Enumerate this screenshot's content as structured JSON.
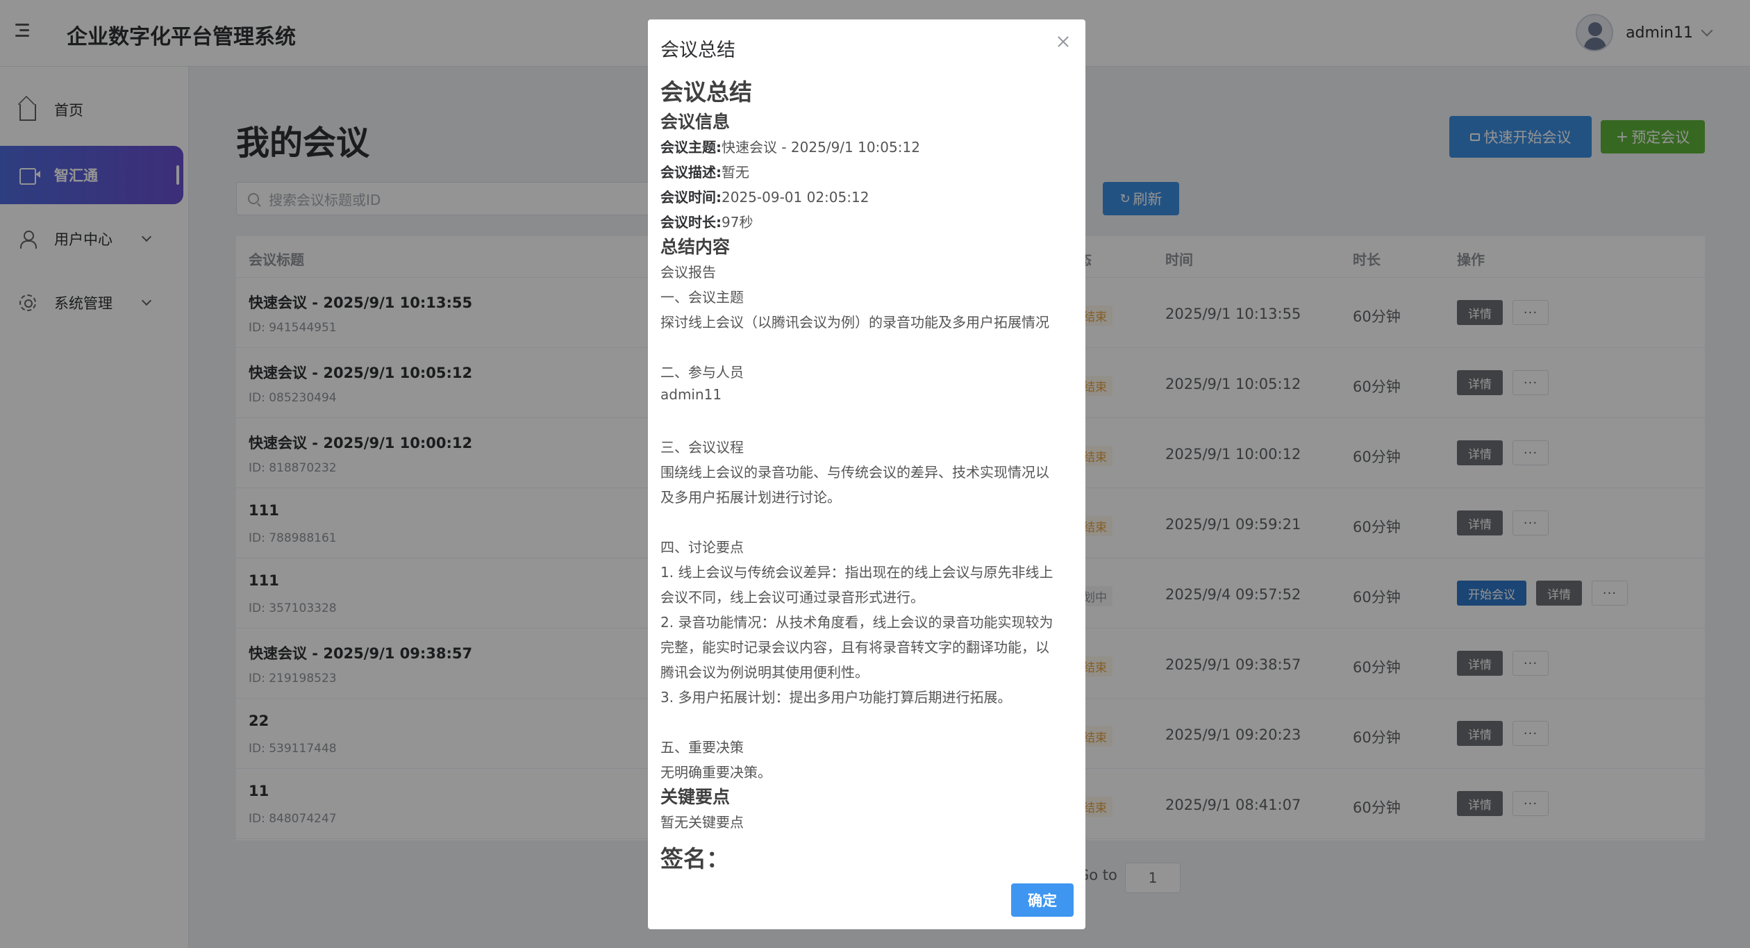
{
  "header": {
    "app_title": "企业数字化平台管理系统",
    "username": "admin11"
  },
  "sidebar": {
    "items": [
      {
        "label": "首页",
        "icon": "home-icon"
      },
      {
        "label": "智汇通",
        "icon": "video-icon"
      },
      {
        "label": "用户中心",
        "icon": "user-icon"
      },
      {
        "label": "系统管理",
        "icon": "gear-icon"
      }
    ]
  },
  "main": {
    "page_title": "我的会议",
    "quick_start_label": "快速开始会议",
    "book_label": "预定会议",
    "refresh_label": "刷新",
    "search_placeholder": "搜索会议标题或ID",
    "columns": {
      "title": "会议标题",
      "status": "态",
      "time": "时间",
      "duration": "时长",
      "ops": "操作"
    },
    "rows": [
      {
        "title": "快速会议 - 2025/9/1 10:13:55",
        "id": "ID: 941544951",
        "status": "结束",
        "time": "2025/9/1 10:13:55",
        "duration": "60分钟",
        "start": "",
        "detail": "详情",
        "more": "···"
      },
      {
        "title": "快速会议 - 2025/9/1 10:05:12",
        "id": "ID: 085230494",
        "status": "结束",
        "time": "2025/9/1 10:05:12",
        "duration": "60分钟",
        "start": "",
        "detail": "详情",
        "more": "···"
      },
      {
        "title": "快速会议 - 2025/9/1 10:00:12",
        "id": "ID: 818870232",
        "status": "结束",
        "time": "2025/9/1 10:00:12",
        "duration": "60分钟",
        "start": "",
        "detail": "详情",
        "more": "···"
      },
      {
        "title": "111",
        "id": "ID: 788988161",
        "status": "结束",
        "time": "2025/9/1 09:59:21",
        "duration": "60分钟",
        "start": "",
        "detail": "详情",
        "more": "···"
      },
      {
        "title": "111",
        "id": "ID: 357103328",
        "status": "划中",
        "time": "2025/9/4 09:57:52",
        "duration": "60分钟",
        "start": "开始会议",
        "detail": "详情",
        "more": "···"
      },
      {
        "title": "快速会议 - 2025/9/1 09:38:57",
        "id": "ID: 219198523",
        "status": "结束",
        "time": "2025/9/1 09:38:57",
        "duration": "60分钟",
        "start": "",
        "detail": "详情",
        "more": "···"
      },
      {
        "title": "22",
        "id": "ID: 539117448",
        "status": "结束",
        "time": "2025/9/1 09:20:23",
        "duration": "60分钟",
        "start": "",
        "detail": "详情",
        "more": "···"
      },
      {
        "title": "11",
        "id": "ID: 848074247",
        "status": "结束",
        "time": "2025/9/1 08:41:07",
        "duration": "60分钟",
        "start": "",
        "detail": "详情",
        "more": "···"
      }
    ],
    "goto_label": "Go to",
    "goto_value": "1"
  },
  "modal": {
    "title": "会议总结",
    "h_summary": "会议总结",
    "h_info": "会议信息",
    "subject_key": "会议主题:",
    "subject_val": "快速会议 - 2025/9/1 10:05:12",
    "desc_key": "会议描述:",
    "desc_val": "暂无",
    "time_key": "会议时间:",
    "time_val": "2025-09-01 02:05:12",
    "dur_key": "会议时长:",
    "dur_val": "97秒",
    "h_content": "总结内容",
    "lines": [
      "会议报告",
      "一、会议主题",
      "探讨线上会议（以腾讯会议为例）的录音功能及多用户拓展情况",
      "二、参与人员",
      "admin11",
      "三、会议议程",
      "围绕线上会议的录音功能、与传统会议的差异、技术实现情况以",
      "及多用户拓展计划进行讨论。",
      "四、讨论要点",
      "1. 线上会议与传统会议差异：指出现在的线上会议与原先非线上",
      "会议不同，线上会议可通过录音形式进行。",
      "2. 录音功能情况：从技术角度看，线上会议的录音功能实现较为",
      "完整，能实时记录会议内容，且有将录音转文字的翻译功能，以",
      "腾讯会议为例说明其使用便利性。",
      "3. 多用户拓展计划：提出多用户功能打算后期进行拓展。",
      "五、重要决策",
      "无明确重要决策。"
    ],
    "h_key_points": "关键要点",
    "key_points": "暂无关键要点",
    "signature": "签名：",
    "ok_label": "确定"
  }
}
